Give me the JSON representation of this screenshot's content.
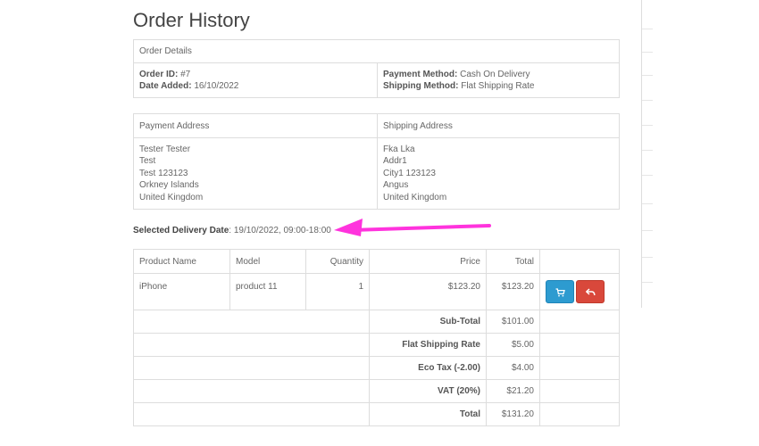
{
  "page": {
    "title": "Order History"
  },
  "order_details": {
    "header": "Order Details",
    "order_id_label": "Order ID:",
    "order_id": "#7",
    "date_added_label": "Date Added:",
    "date_added": "16/10/2022",
    "payment_method_label": "Payment Method:",
    "payment_method": "Cash On Delivery",
    "shipping_method_label": "Shipping Method:",
    "shipping_method": "Flat Shipping Rate"
  },
  "addresses": {
    "payment_header": "Payment Address",
    "shipping_header": "Shipping Address",
    "payment_lines": [
      "Tester Tester",
      "Test",
      "Test 123123",
      "Orkney Islands",
      "United Kingdom"
    ],
    "shipping_lines": [
      "Fka Lka",
      "Addr1",
      "City1 123123",
      "Angus",
      "United Kingdom"
    ]
  },
  "delivery": {
    "label": "Selected Delivery Date",
    "value": ": 19/10/2022, 09:00-18:00"
  },
  "products": {
    "headers": [
      "Product Name",
      "Model",
      "Quantity",
      "Price",
      "Total"
    ],
    "rows": [
      {
        "name": "iPhone",
        "model": "product 11",
        "quantity": "1",
        "price": "$123.20",
        "total": "$123.20"
      }
    ],
    "totals": [
      {
        "label": "Sub-Total",
        "value": "$101.00"
      },
      {
        "label": "Flat Shipping Rate",
        "value": "$5.00"
      },
      {
        "label": "Eco Tax (-2.00)",
        "value": "$4.00"
      },
      {
        "label": "VAT (20%)",
        "value": "$21.20"
      },
      {
        "label": "Total",
        "value": "$131.20"
      }
    ]
  },
  "icons": {
    "reorder": "shopping-cart-icon",
    "return": "reply-icon"
  },
  "colors": {
    "reorder_button": "#2d9bd0",
    "return_button": "#d9483b",
    "annotation_arrow": "#ff33dd"
  }
}
